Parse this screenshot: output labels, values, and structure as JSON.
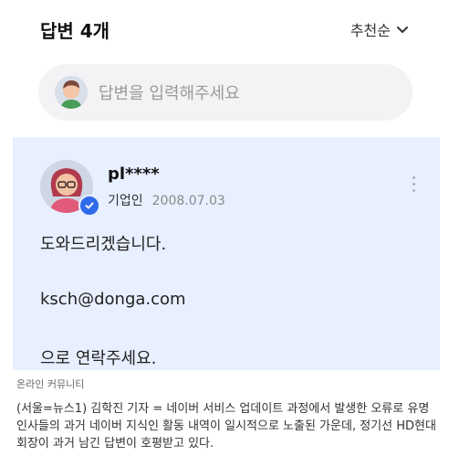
{
  "header": {
    "title": "답변 4개",
    "sort_label": "추천순"
  },
  "answer_input": {
    "placeholder": "답변을 입력해주세요"
  },
  "answer": {
    "username": "pl****",
    "role": "기업인",
    "date": "2008.07.03",
    "lines": [
      "도와드리겠습니다.",
      "ksch@donga.com",
      "으로 연락주세요."
    ]
  },
  "caption": {
    "source": "온라인 커뮤니티"
  },
  "article": {
    "text": "(서울=뉴스1) 김학진 기자 = 네이버 서비스 업데이트 과정에서 발생한 오류로 유명 인사들의 과거 네이버 지식인 활동 내역이 일시적으로 노출된 가운데, 정기선 HD현대 회장이 과거 남긴 답변이 호평받고 있다."
  },
  "icons": {
    "sort": "chevron-down-icon",
    "more": "more-vertical-icon",
    "verified": "verified-check-icon"
  },
  "colors": {
    "card_bg": "#e8efff",
    "badge": "#2f6bea",
    "input_bg": "#f3f3f5"
  }
}
